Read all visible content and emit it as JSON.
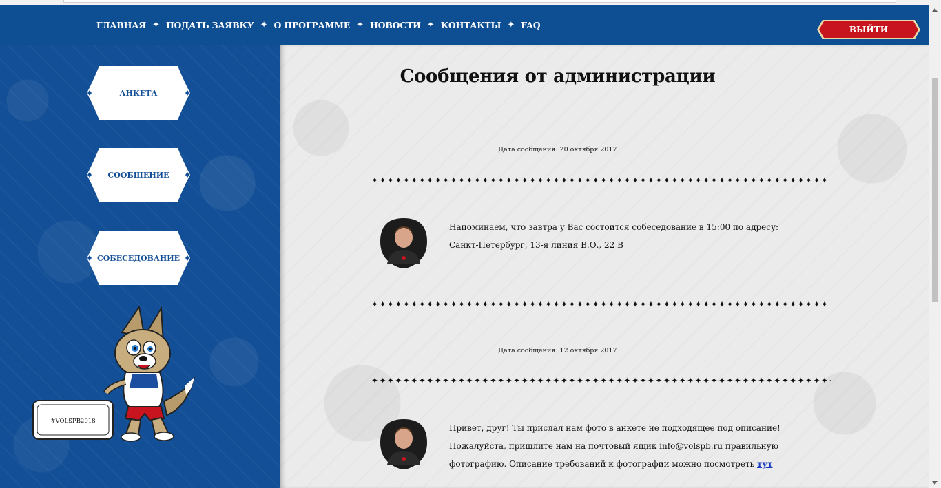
{
  "nav": {
    "items": [
      {
        "label": "ГЛАВНАЯ"
      },
      {
        "label": "ПОДАТЬ ЗАЯВКУ"
      },
      {
        "label": "О ПРОГРАММЕ"
      },
      {
        "label": "НОВОСТИ"
      },
      {
        "label": "КОНТАКТЫ"
      },
      {
        "label": "FAQ"
      }
    ],
    "separator": "✦",
    "logout_label": "ВЫЙТИ"
  },
  "sidebar": {
    "buttons": [
      {
        "label": "АНКЕТА"
      },
      {
        "label": "СООБЩЕНИЕ"
      },
      {
        "label": "СОБЕСЕДОВАНИЕ"
      }
    ],
    "mascot_sign": "#VOLSPB2018"
  },
  "main": {
    "title": "Сообщения от администрации",
    "divider": "✦✦✦✦✦✦✦✦✦✦✦✦✦✦✦✦✦✦✦✦✦✦✦✦✦✦✦✦✦✦✦✦✦✦✦✦✦✦✦✦✦✦✦✦✦✦✦✦✦✦✦✦✦✦✦✦✦✦✦✦✦✦✦",
    "messages": [
      {
        "date": "Дата сообщения: 20 октября 2017",
        "line1": "Напоминаем, что завтра у Вас состоится собеседование в 15:00 по адресу:",
        "line2": "Санкт-Петербург, 13-я линия В.О., 22 В"
      },
      {
        "date": "Дата сообщения: 12 октября 2017",
        "line1": "Привет, друг! Ты прислал нам фото в анкете не подходящее под описание!",
        "line2": "Пожалуйста, пришлите нам на почтовый ящик info@volspb.ru правильную",
        "line3": "фотографию. Описание требований к фотографии можно посмотреть",
        "link": "тут"
      }
    ]
  },
  "colors": {
    "nav_blue": "#0e4f93",
    "sidebar_blue": "#134f96",
    "logout_red": "#c8141e",
    "link": "#1a3cc4"
  },
  "icons": {
    "nav_separator": "star-separator-icon",
    "avatar": "user-avatar-icon",
    "mascot": "wolf-mascot-icon"
  }
}
